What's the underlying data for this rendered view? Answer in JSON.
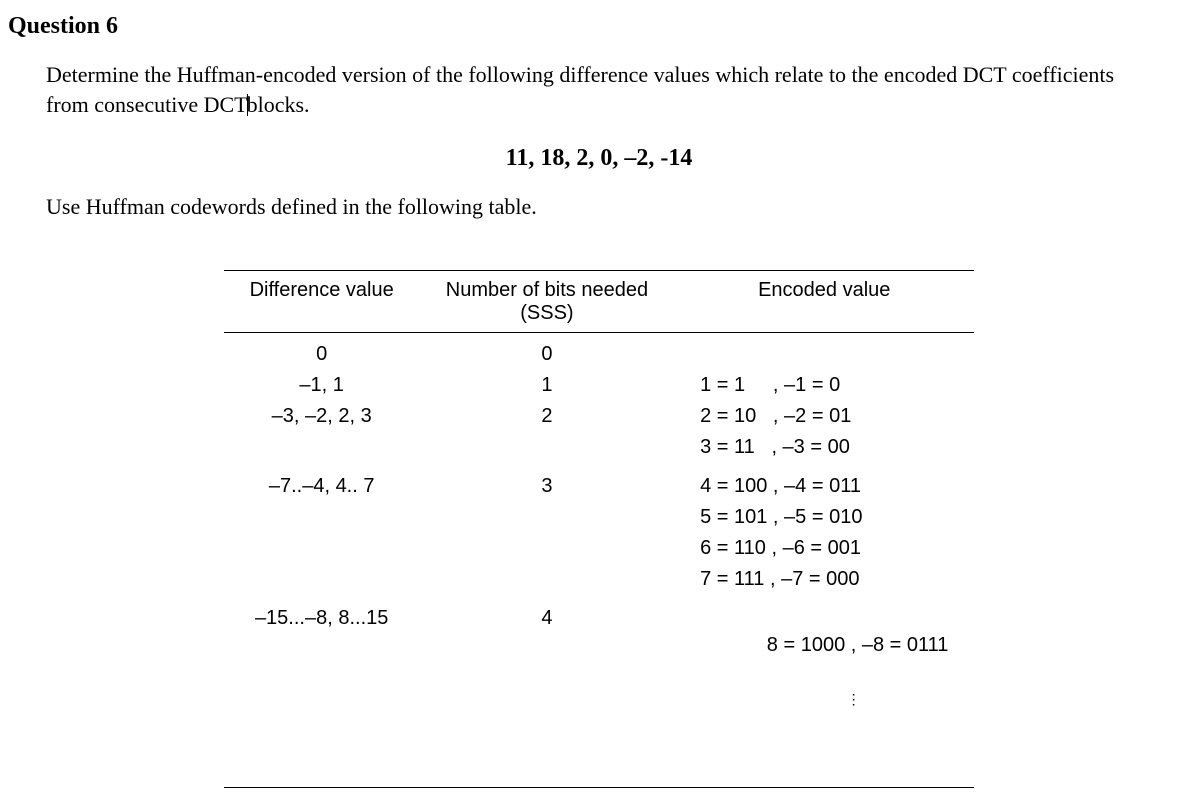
{
  "question_label": "Question 6",
  "intro_part1": "Determine the Huffman-encoded version of the following difference values which relate to the encoded DCT coefficients from consecutive DCT",
  "intro_part2": "blocks.",
  "values_line": "11, 18, 2, 0, –2, -14",
  "instruction": "Use Huffman codewords defined in the following table.",
  "table": {
    "headers": {
      "col1": "Difference value",
      "col2_line1": "Number of bits needed",
      "col2_line2": "(SSS)",
      "col3": "Encoded value"
    },
    "rows": [
      {
        "diff": "0",
        "bits": "0",
        "enc": ""
      },
      {
        "diff": "–1, 1",
        "bits": "1",
        "enc": "1 = 1     , –1 = 0"
      },
      {
        "diff": "–3, –2, 2, 3",
        "bits": "2",
        "enc": "2 = 10   , –2 = 01"
      },
      {
        "diff": "",
        "bits": "",
        "enc": "3 = 11   , –3 = 00"
      },
      {
        "diff": "–7..–4, 4.. 7",
        "bits": "3",
        "enc": "4 = 100 , –4 = 011"
      },
      {
        "diff": "",
        "bits": "",
        "enc": "5 = 101 , –5 = 010"
      },
      {
        "diff": "",
        "bits": "",
        "enc": "6 = 110 , –6 = 001"
      },
      {
        "diff": "",
        "bits": "",
        "enc": "7 = 111 , –7 = 000"
      },
      {
        "diff": "–15...–8, 8...15",
        "bits": "4",
        "enc": "8 = 1000 , –8 = 0111"
      }
    ]
  },
  "chart_data": {
    "type": "table",
    "title": "Huffman SSS encoding table for DCT difference values",
    "columns": [
      "Difference value",
      "Number of bits needed (SSS)",
      "Encoded value"
    ],
    "rows": [
      [
        "0",
        0,
        ""
      ],
      [
        "-1, 1",
        1,
        "1=1, -1=0"
      ],
      [
        "-3, -2, 2, 3",
        2,
        "2=10, -2=01, 3=11, -3=00"
      ],
      [
        "-7..-4, 4..7",
        3,
        "4=100, -4=011, 5=101, -5=010, 6=110, -6=001, 7=111, -7=000"
      ],
      [
        "-15..-8, 8..15",
        4,
        "8=1000, -8=0111"
      ]
    ]
  }
}
